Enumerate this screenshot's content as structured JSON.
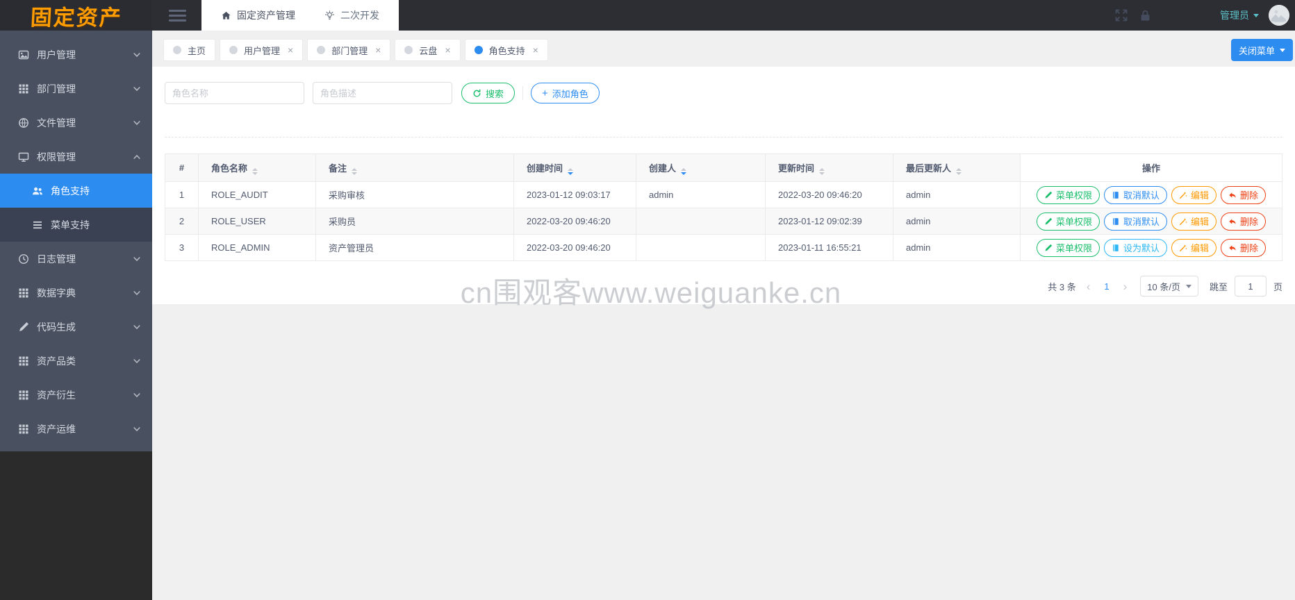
{
  "brand": {
    "logo_text": "固定资产"
  },
  "topbar": {
    "breadcrumb": {
      "home": "固定资产管理",
      "dev": "二次开发"
    },
    "user_name": "管理员"
  },
  "sidebar": {
    "items": [
      {
        "label": "用户管理"
      },
      {
        "label": "部门管理"
      },
      {
        "label": "文件管理"
      },
      {
        "label": "权限管理"
      },
      {
        "label": "角色支持"
      },
      {
        "label": "菜单支持"
      },
      {
        "label": "日志管理"
      },
      {
        "label": "数据字典"
      },
      {
        "label": "代码生成"
      },
      {
        "label": "资产品类"
      },
      {
        "label": "资产衍生"
      },
      {
        "label": "资产运维"
      }
    ]
  },
  "tabstrip": {
    "tabs": [
      {
        "label": "主页"
      },
      {
        "label": "用户管理"
      },
      {
        "label": "部门管理"
      },
      {
        "label": "云盘"
      },
      {
        "label": "角色支持"
      }
    ],
    "close_label": "×",
    "close_menu": "关闭菜单"
  },
  "filters": {
    "name_placeholder": "角色名称",
    "desc_placeholder": "角色描述",
    "search_label": "搜索",
    "add_label": "添加角色"
  },
  "table": {
    "headers": [
      "#",
      "角色名称",
      "备注",
      "创建时间",
      "创建人",
      "更新时间",
      "最后更新人",
      "操作"
    ],
    "rows": [
      {
        "index": "1",
        "name": "ROLE_AUDIT",
        "remark": "采购审核",
        "created": "2023-01-12 09:03:17",
        "creator": "admin",
        "updated": "2022-03-20 09:46:20",
        "updater": "admin",
        "actions": [
          "菜单权限",
          "取消默认",
          "编辑",
          "删除"
        ]
      },
      {
        "index": "2",
        "name": "ROLE_USER",
        "remark": "采购员",
        "created": "2022-03-20 09:46:20",
        "creator": "",
        "updated": "2023-01-12 09:02:39",
        "updater": "admin",
        "actions": [
          "菜单权限",
          "取消默认",
          "编辑",
          "删除"
        ]
      },
      {
        "index": "3",
        "name": "ROLE_ADMIN",
        "remark": "资产管理员",
        "created": "2022-03-20 09:46:20",
        "creator": "",
        "updated": "2023-01-11 16:55:21",
        "updater": "admin",
        "actions": [
          "菜单权限",
          "设为默认",
          "编辑",
          "删除"
        ]
      }
    ]
  },
  "pagination": {
    "total": "共 3 条",
    "prev": "‹",
    "current_page": "1",
    "next": "›",
    "page_size": "10 条/页",
    "jump_label": "跳至",
    "jump_value": "1",
    "page_unit": "页"
  },
  "watermark": "cn围观客www.weiguanke.cn",
  "colors": {
    "primary": "#2d8cf0",
    "success": "#19be6b",
    "warning": "#ff9900",
    "error": "#ed4014",
    "info": "#2db7f5",
    "sidebar": "#495060",
    "header": "#2d2e33"
  }
}
